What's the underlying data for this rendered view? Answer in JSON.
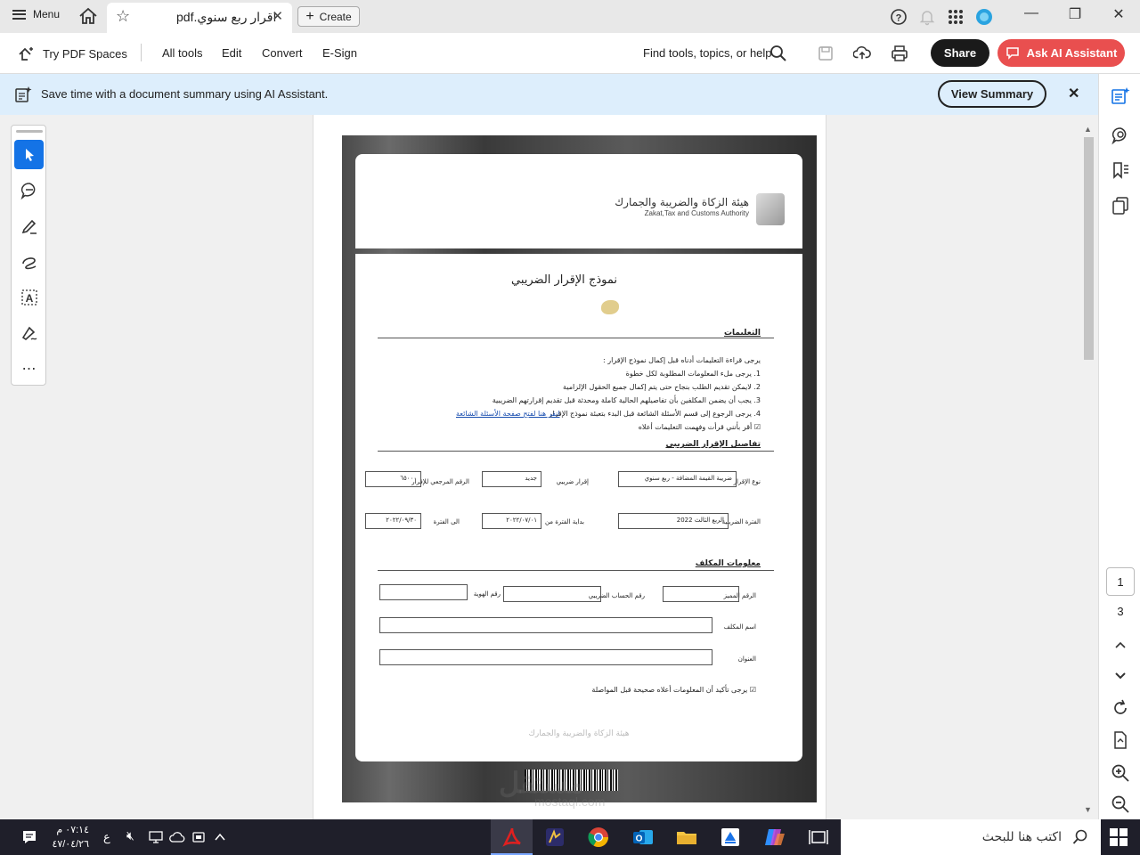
{
  "titlebar": {
    "menu_label": "Menu",
    "tab_title": "اقرار ربع سنوي.pdf",
    "create_label": "Create"
  },
  "toolbar": {
    "pdf_spaces": "Try PDF Spaces",
    "nav": [
      "All tools",
      "Edit",
      "Convert",
      "E-Sign"
    ],
    "find_placeholder": "Find tools, topics, or help",
    "share_label": "Share",
    "ai_label": "Ask AI Assistant"
  },
  "banner": {
    "text": "Save time with a document summary using AI Assistant.",
    "button_label": "View Summary"
  },
  "pagination": {
    "current": "1",
    "total": "3"
  },
  "document": {
    "org_name_ar": "هيئة الزكاة والضريبة والجمارك",
    "org_name_en": "Zakat,Tax and Customs Authority",
    "form_title": "نموذج الإقرار الضريبي",
    "instructions_heading": "التعليمات",
    "instructions_intro": "يرجى قراءة التعليمات أدناه قبل إكمال نموذج الإقرار :",
    "instructions": [
      "1. يرجى ملء المعلومات المطلوبة لكل خطوة",
      "2. لايمكن تقديم الطلب بنجاح حتى يتم إكمال جميع الحقول الإلزامية",
      "3. يجب أن يضمن المكلفين بأن تفاصيلهم الحالية كاملة ومحدثة قبل تقديم إقرارتهم الضريبية",
      "4. يرجى الرجوع إلى قسم الأسئلة الشائعة قبل البدء بتعبئة نموذج الإقرار"
    ],
    "faq_link": "انقر هنا لفتح صفحة الأسئلة الشائعة",
    "ack_text": "أقر بأنني قرأت وفهمت التعليمات أعلاه",
    "details_heading": "تفاصيل الإقرار الضريبي",
    "fields": {
      "return_type_label": "نوع الإقرار",
      "return_type_value": "ضريبة القيمة المضافة - ربع سنوي",
      "tax_return_label": "إقرار ضريبي",
      "tax_return_value": "جديد",
      "ref_label": "الرقم المرجعي للإقرار",
      "ref_value": "٦٥٠٠٠",
      "period_label": "الفترة الضريبية",
      "period_value": "الربع الثالث 2022",
      "start_label": "بداية الفترة من",
      "start_value": "٢٠٢٢/٠٧/٠١",
      "end_label": "الى الفترة",
      "end_value": "٢٠٢٢/٠٩/٣٠"
    },
    "taxpayer_heading": "معلومات المكلف",
    "taxpayer": {
      "unique_label": "الرقم المميز",
      "account_label": "رقم الحساب الضريبي",
      "id_label": "رقم الهوية",
      "name_label": "اسم المكلف",
      "address_label": "العنوان"
    },
    "confirm_text": "يرجى تأكيد أن المعلومات أعلاه صحيحة قبل المواصلة",
    "footer": "هيئة الزكاة والضريبة والجمارك"
  },
  "watermark": {
    "ar": "مستقل",
    "en": "mostaql.com"
  },
  "taskbar": {
    "time": "٠٧:١٤ م",
    "date": "٤٧/٠٤/٢٦",
    "lang": "ع",
    "search_placeholder": "اكتب هنا للبحث"
  },
  "colors": {
    "accent": "#1473e6",
    "ai_button": "#e94f4f",
    "banner": "#ddeefc",
    "taskbar": "#1f1f2a"
  }
}
